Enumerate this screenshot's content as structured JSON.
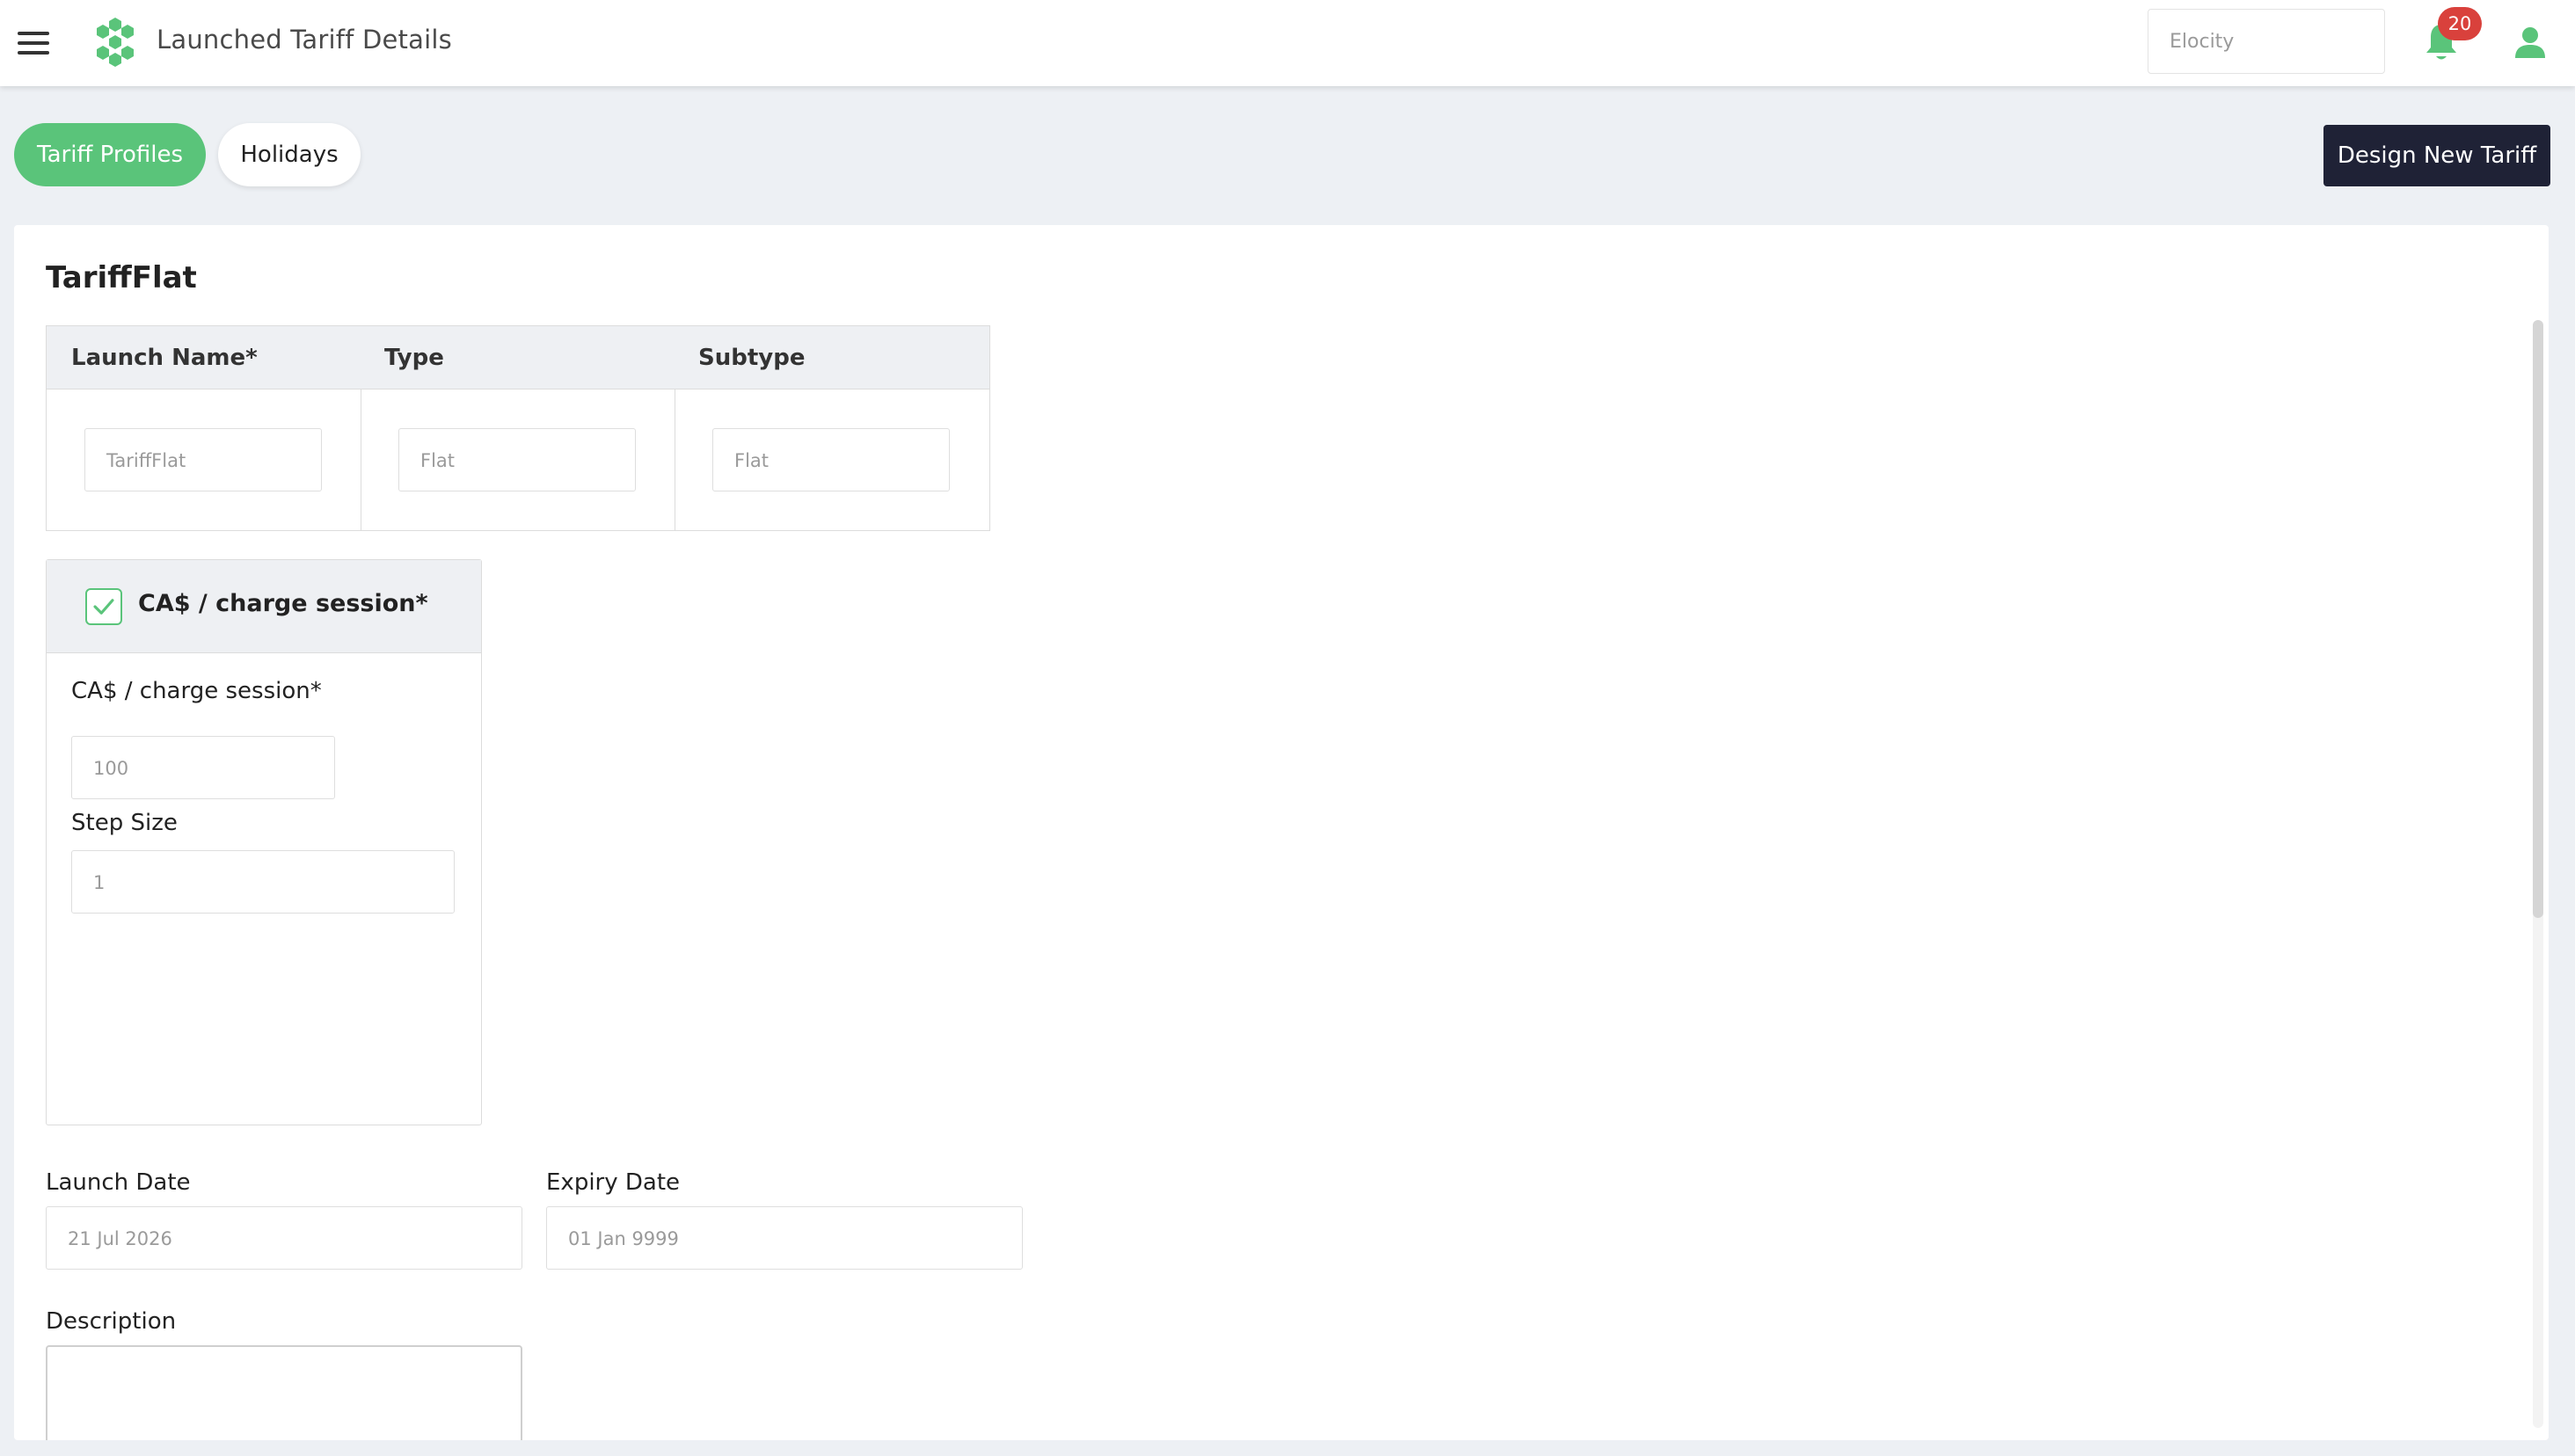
{
  "header": {
    "title": "Launched Tariff Details",
    "org_value": "Elocity",
    "notification_count": "20",
    "icons": {
      "menu": "hamburger-icon",
      "logo": "hexagon-cluster-logo",
      "notifications": "bell-icon",
      "account": "user-icon"
    }
  },
  "tabs": [
    {
      "label": "Tariff Profiles",
      "active": true
    },
    {
      "label": "Holidays",
      "active": false
    }
  ],
  "actions": {
    "design_new": "Design New Tariff"
  },
  "card": {
    "title": "TariffFlat",
    "info_table": {
      "columns": [
        "Launch Name*",
        "Type",
        "Subtype"
      ],
      "values": [
        "TariffFlat",
        "Flat",
        "Flat"
      ]
    },
    "charge": {
      "header_label": "CA$ / charge session*",
      "checked": true,
      "amount_label": "CA$ / charge session*",
      "amount_value": "100",
      "step_label": "Step Size",
      "step_value": "1"
    },
    "dates": {
      "launch_label": "Launch Date",
      "launch_value": "21 Jul 2026",
      "expiry_label": "Expiry Date",
      "expiry_value": "01 Jan 9999"
    },
    "description_label": "Description",
    "description_value": ""
  },
  "colors": {
    "accent_green": "#5ac47a",
    "primary_button": "#1f2236",
    "badge_red": "#d9413c",
    "page_bg": "#edf0f4"
  }
}
